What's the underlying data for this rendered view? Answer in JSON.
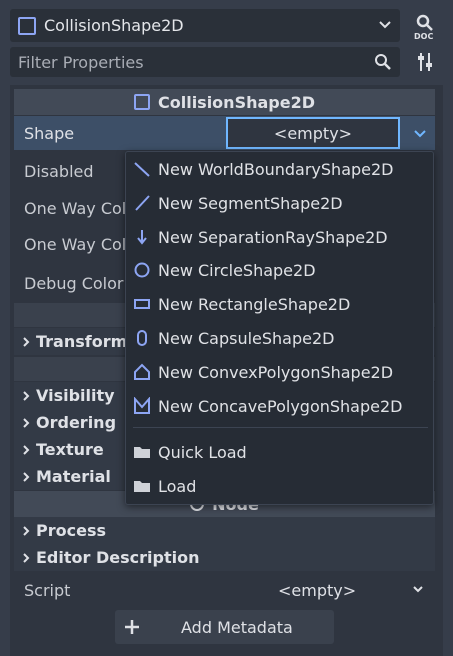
{
  "header": {
    "node_name": "CollisionShape2D",
    "filter_placeholder": "Filter Properties"
  },
  "inspector": {
    "class_title": "CollisionShape2D",
    "properties": [
      {
        "label": "Shape",
        "value": "<empty>"
      },
      {
        "label": "Disabled"
      },
      {
        "label": "One Way Col"
      },
      {
        "label": "One Way Col"
      },
      {
        "label": "Debug Color"
      }
    ],
    "groups_canvas": [
      "Transform",
      "Visibility",
      "Ordering",
      "Texture",
      "Material"
    ],
    "node_section_title": "Node",
    "groups_node": [
      "Process",
      "Editor Description"
    ],
    "script": {
      "label": "Script",
      "value": "<empty>"
    },
    "add_metadata_label": "Add Metadata"
  },
  "menu": {
    "items": [
      {
        "label": "New WorldBoundaryShape2D",
        "icon": "world-boundary-icon"
      },
      {
        "label": "New SegmentShape2D",
        "icon": "segment-icon"
      },
      {
        "label": "New SeparationRayShape2D",
        "icon": "separation-ray-icon"
      },
      {
        "label": "New CircleShape2D",
        "icon": "circle-icon"
      },
      {
        "label": "New RectangleShape2D",
        "icon": "rectangle-icon"
      },
      {
        "label": "New CapsuleShape2D",
        "icon": "capsule-icon"
      },
      {
        "label": "New ConvexPolygonShape2D",
        "icon": "convex-polygon-icon"
      },
      {
        "label": "New ConcavePolygonShape2D",
        "icon": "concave-polygon-icon"
      }
    ],
    "load_items": [
      {
        "label": "Quick Load",
        "icon": "folder-icon"
      },
      {
        "label": "Load",
        "icon": "folder-icon"
      }
    ]
  },
  "colors": {
    "accent": "#70b7ff",
    "shape_icon": "#8da5f3",
    "background": "#363d4a"
  }
}
